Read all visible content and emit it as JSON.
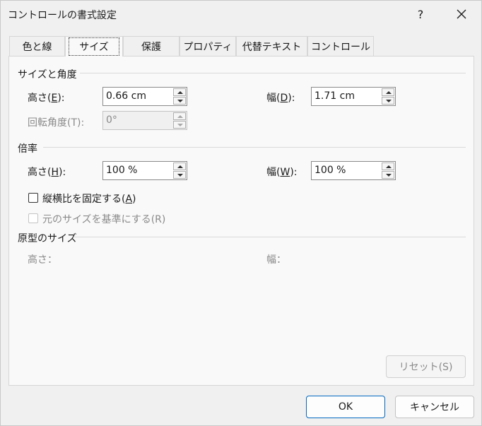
{
  "window": {
    "title": "コントロールの書式設定",
    "help_label": "?"
  },
  "tabs": [
    {
      "label": "色と線"
    },
    {
      "label": "サイズ"
    },
    {
      "label": "保護"
    },
    {
      "label": "プロパティ"
    },
    {
      "label": "代替テキスト"
    },
    {
      "label": "コントロール"
    }
  ],
  "size_rotate": {
    "title": "サイズと角度",
    "height_label": "高さ(",
    "height_key": "E",
    "height_suffix": "):",
    "height_value": "0.66 cm",
    "width_label": "幅(",
    "width_key": "D",
    "width_suffix": "):",
    "width_value": "1.71 cm",
    "rotation_label": "回転角度(T):",
    "rotation_value": "0°"
  },
  "scale": {
    "title": "倍率",
    "height_label": "高さ(",
    "height_key": "H",
    "height_suffix": "):",
    "height_value": "100 %",
    "width_label": "幅(",
    "width_key": "W",
    "width_suffix": "):",
    "width_value": "100 %",
    "lock_aspect_label": "縦横比を固定する(",
    "lock_aspect_key": "A",
    "lock_aspect_suffix": ")",
    "relative_label": "元のサイズを基準にする(R)"
  },
  "original": {
    "title": "原型のサイズ",
    "height_label": "高さ：",
    "width_label": "幅："
  },
  "buttons": {
    "reset": "リセット(S)",
    "ok": "OK",
    "cancel": "キャンセル"
  }
}
